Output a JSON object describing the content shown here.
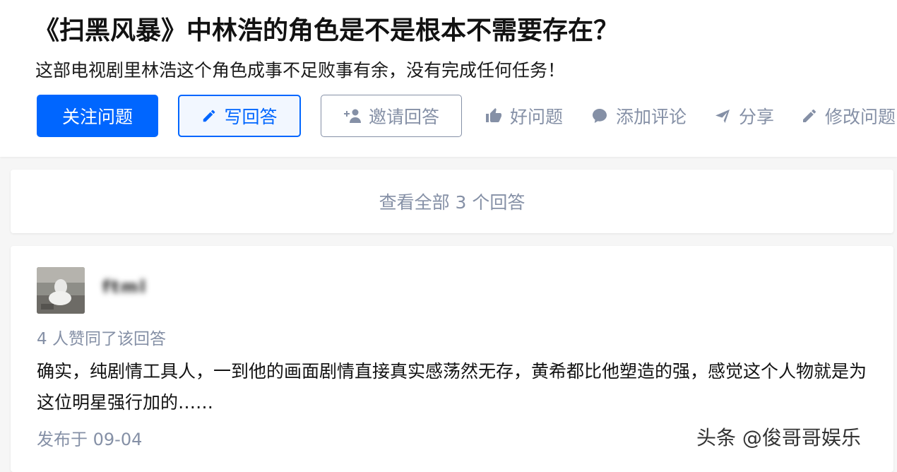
{
  "question": {
    "title": "《扫黑风暴》中林浩的角色是不是根本不需要存在？",
    "description": "这部电视剧里林浩这个角色成事不足败事有余，没有完成任何任务！"
  },
  "buttons": {
    "follow": "关注问题",
    "write_answer": "写回答",
    "invite": "邀请回答"
  },
  "actions": {
    "good_question": "好问题",
    "add_comment": "添加评论",
    "share": "分享",
    "edit_question": "修改问题"
  },
  "view_all": "查看全部 3 个回答",
  "answer": {
    "author_name": "ftml",
    "votes_text": "4 人赞同了该回答",
    "content": "确实，纯剧情工具人，一到他的画面剧情直接真实感荡然无存，黄希都比他塑造的强，感觉这个人物就是为这位明星强行加的……",
    "published": "发布于 09-04"
  },
  "watermark": "头条 @俊哥哥娱乐",
  "colors": {
    "primary": "#0066ff",
    "muted": "#8590a6",
    "background": "#f6f6f6"
  },
  "icons": {
    "write": "pencil-icon",
    "invite": "add-person-icon",
    "good": "thumbs-up-icon",
    "comment": "comment-bubble-icon",
    "share": "paper-plane-icon",
    "edit": "pencil-icon"
  }
}
